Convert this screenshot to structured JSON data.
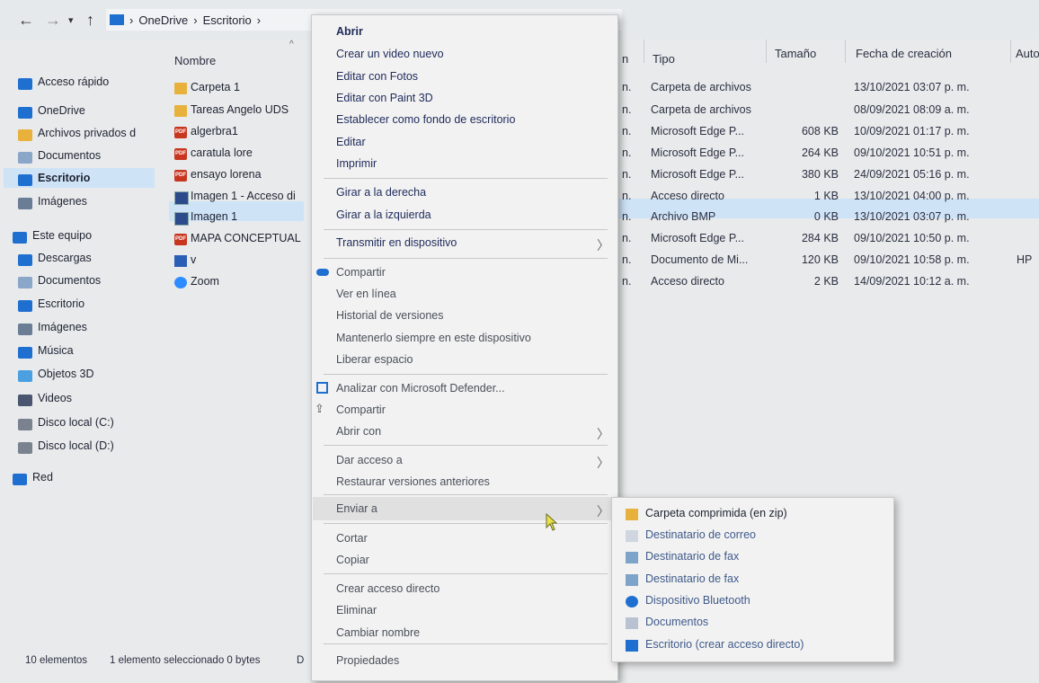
{
  "breadcrumb": {
    "segments": [
      "OneDrive",
      "Escritorio"
    ]
  },
  "columns": {
    "nombre": "Nombre",
    "fecha_mod_fragment": "n",
    "tipo": "Tipo",
    "tamano": "Tamaño",
    "fecha_creacion": "Fecha de creación",
    "autor": "Auto"
  },
  "sidebar": {
    "items": [
      {
        "label": "Acceso rápido",
        "icon": "star-icon"
      },
      {
        "label": "OneDrive",
        "icon": "cloud-icon"
      },
      {
        "label": "Archivos privados d",
        "icon": "folder-icon"
      },
      {
        "label": "Documentos",
        "icon": "document-icon"
      },
      {
        "label": "Escritorio",
        "icon": "desktop-icon"
      },
      {
        "label": "Imágenes",
        "icon": "pictures-icon"
      },
      {
        "label": "Este equipo",
        "icon": "computer-icon"
      },
      {
        "label": "Descargas",
        "icon": "download-icon"
      },
      {
        "label": "Documentos",
        "icon": "document-icon"
      },
      {
        "label": "Escritorio",
        "icon": "desktop-icon"
      },
      {
        "label": "Imágenes",
        "icon": "pictures-icon"
      },
      {
        "label": "Música",
        "icon": "music-icon"
      },
      {
        "label": "Objetos 3D",
        "icon": "cube-icon"
      },
      {
        "label": "Videos",
        "icon": "video-icon"
      },
      {
        "label": "Disco local (C:)",
        "icon": "drive-icon"
      },
      {
        "label": "Disco local (D:)",
        "icon": "drive-icon"
      },
      {
        "label": "Red",
        "icon": "network-icon"
      }
    ]
  },
  "files": [
    {
      "name": "Carpeta 1",
      "tipo": "Carpeta de archivos",
      "tamano": "",
      "fecha": "13/10/2021 03:07 p. m.",
      "autor": ""
    },
    {
      "name": "Tareas Angelo UDS",
      "tipo": "Carpeta de archivos",
      "tamano": "",
      "fecha": "08/09/2021 08:09 a. m.",
      "autor": ""
    },
    {
      "name": "algerbra1",
      "tipo": "Microsoft Edge P...",
      "tamano": "608 KB",
      "fecha": "10/09/2021 01:17 p. m.",
      "autor": ""
    },
    {
      "name": "caratula lore",
      "tipo": "Microsoft Edge P...",
      "tamano": "264 KB",
      "fecha": "09/10/2021 10:51 p. m.",
      "autor": ""
    },
    {
      "name": "ensayo lorena",
      "tipo": "Microsoft Edge P...",
      "tamano": "380 KB",
      "fecha": "24/09/2021 05:16 p. m.",
      "autor": ""
    },
    {
      "name": "Imagen 1 - Acceso di",
      "tipo": "Acceso directo",
      "tamano": "1 KB",
      "fecha": "13/10/2021 04:00 p. m.",
      "autor": ""
    },
    {
      "name": "Imagen 1",
      "tipo": "Archivo BMP",
      "tamano": "0 KB",
      "fecha": "13/10/2021 03:07 p. m.",
      "autor": ""
    },
    {
      "name": "MAPA CONCEPTUAL",
      "tipo": "Microsoft Edge P...",
      "tamano": "284 KB",
      "fecha": "09/10/2021 10:50 p. m.",
      "autor": ""
    },
    {
      "name": "v",
      "tipo": "Documento de Mi...",
      "tamano": "120 KB",
      "fecha": "09/10/2021 10:58 p. m.",
      "autor": "HP"
    },
    {
      "name": "Zoom",
      "tipo": "Acceso directo",
      "tamano": "2 KB",
      "fecha": "14/09/2021 10:12 a. m.",
      "autor": ""
    }
  ],
  "file_icons": [
    "folder-icon",
    "folder-icon",
    "pdf-icon",
    "pdf-icon",
    "pdf-icon",
    "shortcut-icon",
    "bmp-icon",
    "pdf-icon",
    "word-icon",
    "zoom-icon"
  ],
  "context_menu": {
    "items": [
      "Abrir",
      "Crear un video nuevo",
      "Editar con Fotos",
      "Editar con Paint 3D",
      "Establecer como fondo de escritorio",
      "Editar",
      "Imprimir",
      "Girar a la derecha",
      "Girar a la izquierda",
      "Transmitir en dispositivo",
      "Compartir",
      "Ver en línea",
      "Historial de versiones",
      "Mantenerlo siempre en este dispositivo",
      "Liberar espacio",
      "Analizar con Microsoft Defender...",
      "Compartir",
      "Abrir con",
      "Dar acceso a",
      "Restaurar versiones anteriores",
      "Enviar a",
      "Cortar",
      "Copiar",
      "Crear acceso directo",
      "Eliminar",
      "Cambiar nombre",
      "Propiedades"
    ]
  },
  "send_to_menu": {
    "items": [
      {
        "label": "Carpeta comprimida (en zip)",
        "icon": "zip-folder-icon"
      },
      {
        "label": "Destinatario de correo",
        "icon": "mail-icon"
      },
      {
        "label": "Destinatario de fax",
        "icon": "fax-icon"
      },
      {
        "label": "Destinatario de fax",
        "icon": "fax-icon"
      },
      {
        "label": "Dispositivo Bluetooth",
        "icon": "bluetooth-icon"
      },
      {
        "label": "Documentos",
        "icon": "document-icon"
      },
      {
        "label": "Escritorio (crear acceso directo)",
        "icon": "desktop-icon"
      }
    ]
  },
  "status": {
    "count": "10 elementos",
    "selection": "1 elemento seleccionado 0 bytes",
    "extra": "D"
  },
  "colors": {
    "selection": "#cfe3f7",
    "menu_bg": "#f2f2f2",
    "folder": "#e8b13b",
    "pdf": "#c8361f",
    "accent": "#1f6fd1"
  }
}
